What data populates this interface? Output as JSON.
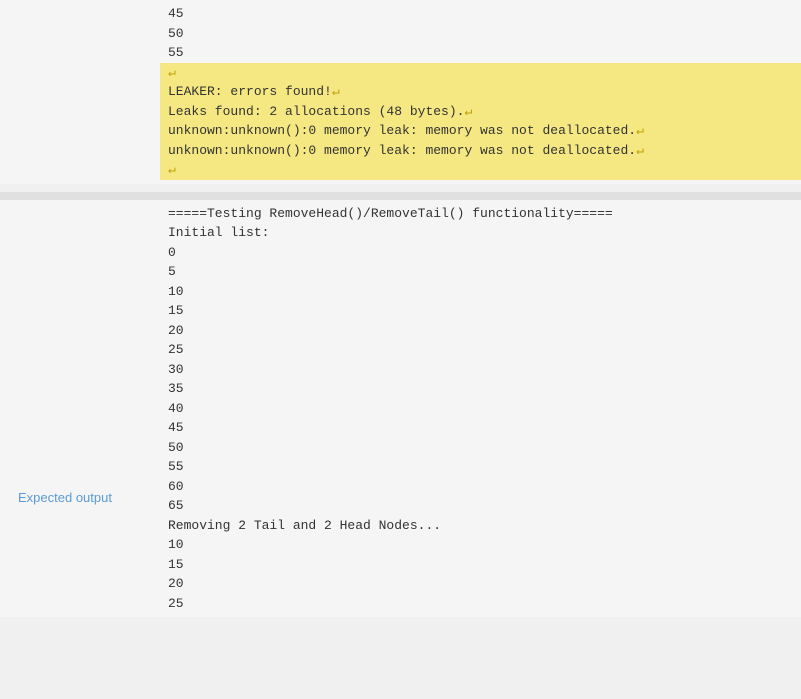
{
  "top_section": {
    "lines": [
      {
        "text": "45",
        "highlighted": false
      },
      {
        "text": "50",
        "highlighted": false
      },
      {
        "text": "55",
        "highlighted": false
      },
      {
        "text": "↵",
        "highlighted": true,
        "is_return": true
      },
      {
        "text": "LEAKER: errors found!↵",
        "highlighted": true
      },
      {
        "text": "Leaks found: 2 allocations (48 bytes).↵",
        "highlighted": true
      },
      {
        "text": "unknown:unknown():0 memory leak: memory was not deallocated.↵",
        "highlighted": true
      },
      {
        "text": "unknown:unknown():0 memory leak: memory was not deallocated.↵",
        "highlighted": true
      },
      {
        "text": "↵",
        "highlighted": true,
        "is_return": true
      }
    ]
  },
  "bottom_section": {
    "label": "Expected output",
    "lines": [
      {
        "text": "=====Testing RemoveHead()/RemoveTail() functionality====="
      },
      {
        "text": "Initial list:"
      },
      {
        "text": "0"
      },
      {
        "text": "5"
      },
      {
        "text": "10"
      },
      {
        "text": "15"
      },
      {
        "text": "20"
      },
      {
        "text": "25"
      },
      {
        "text": "30"
      },
      {
        "text": "35"
      },
      {
        "text": "40"
      },
      {
        "text": "45"
      },
      {
        "text": "50"
      },
      {
        "text": "55"
      },
      {
        "text": "60"
      },
      {
        "text": "65"
      },
      {
        "text": "Removing 2 Tail and 2 Head Nodes..."
      },
      {
        "text": "10"
      },
      {
        "text": "15"
      },
      {
        "text": "20"
      },
      {
        "text": "25"
      }
    ]
  }
}
